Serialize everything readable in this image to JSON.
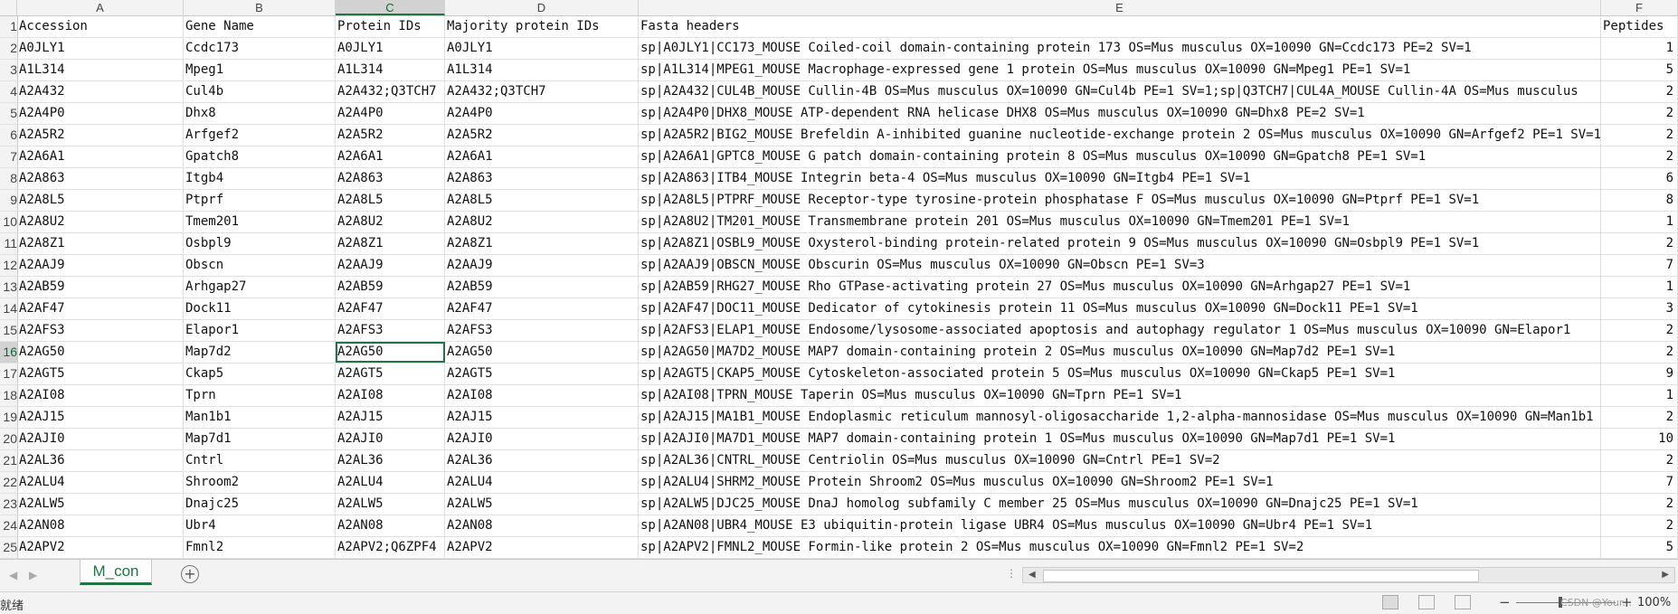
{
  "columns": [
    "A",
    "B",
    "C",
    "D",
    "E",
    "F"
  ],
  "selected_column": "C",
  "headers": {
    "rownum": "1",
    "cells": [
      "Accession",
      "Gene Name",
      "Protein IDs",
      "Majority protein IDs",
      "Fasta headers",
      "Peptides"
    ]
  },
  "rows": [
    {
      "n": "2",
      "cells": [
        "A0JLY1",
        "Ccdc173",
        "A0JLY1",
        "A0JLY1",
        "sp|A0JLY1|CC173_MOUSE Coiled-coil domain-containing protein 173 OS=Mus musculus OX=10090 GN=Ccdc173 PE=2 SV=1",
        "1"
      ]
    },
    {
      "n": "3",
      "cells": [
        "A1L314",
        "Mpeg1",
        "A1L314",
        "A1L314",
        "sp|A1L314|MPEG1_MOUSE Macrophage-expressed gene 1 protein OS=Mus musculus OX=10090 GN=Mpeg1 PE=1 SV=1",
        "5"
      ]
    },
    {
      "n": "4",
      "cells": [
        "A2A432",
        "Cul4b",
        "A2A432;Q3TCH7",
        "A2A432;Q3TCH7",
        "sp|A2A432|CUL4B_MOUSE Cullin-4B OS=Mus musculus OX=10090 GN=Cul4b PE=1 SV=1;sp|Q3TCH7|CUL4A_MOUSE Cullin-4A OS=Mus musculus",
        "2"
      ]
    },
    {
      "n": "5",
      "cells": [
        "A2A4P0",
        "Dhx8",
        "A2A4P0",
        "A2A4P0",
        "sp|A2A4P0|DHX8_MOUSE ATP-dependent RNA helicase DHX8 OS=Mus musculus OX=10090 GN=Dhx8 PE=2 SV=1",
        "2"
      ]
    },
    {
      "n": "6",
      "cells": [
        "A2A5R2",
        "Arfgef2",
        "A2A5R2",
        "A2A5R2",
        "sp|A2A5R2|BIG2_MOUSE Brefeldin A-inhibited guanine nucleotide-exchange protein 2 OS=Mus musculus OX=10090 GN=Arfgef2 PE=1 SV=1",
        "2"
      ]
    },
    {
      "n": "7",
      "cells": [
        "A2A6A1",
        "Gpatch8",
        "A2A6A1",
        "A2A6A1",
        "sp|A2A6A1|GPTC8_MOUSE G patch domain-containing protein 8 OS=Mus musculus OX=10090 GN=Gpatch8 PE=1 SV=1",
        "2"
      ]
    },
    {
      "n": "8",
      "cells": [
        "A2A863",
        "Itgb4",
        "A2A863",
        "A2A863",
        "sp|A2A863|ITB4_MOUSE Integrin beta-4 OS=Mus musculus OX=10090 GN=Itgb4 PE=1 SV=1",
        "6"
      ]
    },
    {
      "n": "9",
      "cells": [
        "A2A8L5",
        "Ptprf",
        "A2A8L5",
        "A2A8L5",
        "sp|A2A8L5|PTPRF_MOUSE Receptor-type tyrosine-protein phosphatase F OS=Mus musculus OX=10090 GN=Ptprf PE=1 SV=1",
        "8"
      ]
    },
    {
      "n": "10",
      "cells": [
        "A2A8U2",
        "Tmem201",
        "A2A8U2",
        "A2A8U2",
        "sp|A2A8U2|TM201_MOUSE Transmembrane protein 201 OS=Mus musculus OX=10090 GN=Tmem201 PE=1 SV=1",
        "1"
      ]
    },
    {
      "n": "11",
      "cells": [
        "A2A8Z1",
        "Osbpl9",
        "A2A8Z1",
        "A2A8Z1",
        "sp|A2A8Z1|OSBL9_MOUSE Oxysterol-binding protein-related protein 9 OS=Mus musculus OX=10090 GN=Osbpl9 PE=1 SV=1",
        "2"
      ]
    },
    {
      "n": "12",
      "cells": [
        "A2AAJ9",
        "Obscn",
        "A2AAJ9",
        "A2AAJ9",
        "sp|A2AAJ9|OBSCN_MOUSE Obscurin OS=Mus musculus OX=10090 GN=Obscn PE=1 SV=3",
        "7"
      ]
    },
    {
      "n": "13",
      "cells": [
        "A2AB59",
        "Arhgap27",
        "A2AB59",
        "A2AB59",
        "sp|A2AB59|RHG27_MOUSE Rho GTPase-activating protein 27 OS=Mus musculus OX=10090 GN=Arhgap27 PE=1 SV=1",
        "1"
      ]
    },
    {
      "n": "14",
      "cells": [
        "A2AF47",
        "Dock11",
        "A2AF47",
        "A2AF47",
        "sp|A2AF47|DOC11_MOUSE Dedicator of cytokinesis protein 11 OS=Mus musculus OX=10090 GN=Dock11 PE=1 SV=1",
        "3"
      ]
    },
    {
      "n": "15",
      "cells": [
        "A2AFS3",
        "Elapor1",
        "A2AFS3",
        "A2AFS3",
        "sp|A2AFS3|ELAP1_MOUSE Endosome/lysosome-associated apoptosis and autophagy regulator 1 OS=Mus musculus OX=10090 GN=Elapor1",
        "2"
      ]
    },
    {
      "n": "16",
      "cells": [
        "A2AG50",
        "Map7d2",
        "A2AG50",
        "A2AG50",
        "sp|A2AG50|MA7D2_MOUSE MAP7 domain-containing protein 2 OS=Mus musculus OX=10090 GN=Map7d2 PE=1 SV=1",
        "2"
      ]
    },
    {
      "n": "17",
      "cells": [
        "A2AGT5",
        "Ckap5",
        "A2AGT5",
        "A2AGT5",
        "sp|A2AGT5|CKAP5_MOUSE Cytoskeleton-associated protein 5 OS=Mus musculus OX=10090 GN=Ckap5 PE=1 SV=1",
        "9"
      ]
    },
    {
      "n": "18",
      "cells": [
        "A2AI08",
        "Tprn",
        "A2AI08",
        "A2AI08",
        "sp|A2AI08|TPRN_MOUSE Taperin OS=Mus musculus OX=10090 GN=Tprn PE=1 SV=1",
        "1"
      ]
    },
    {
      "n": "19",
      "cells": [
        "A2AJ15",
        "Man1b1",
        "A2AJ15",
        "A2AJ15",
        "sp|A2AJ15|MA1B1_MOUSE Endoplasmic reticulum mannosyl-oligosaccharide 1,2-alpha-mannosidase OS=Mus musculus OX=10090 GN=Man1b1",
        "2"
      ]
    },
    {
      "n": "20",
      "cells": [
        "A2AJI0",
        "Map7d1",
        "A2AJI0",
        "A2AJI0",
        "sp|A2AJI0|MA7D1_MOUSE MAP7 domain-containing protein 1 OS=Mus musculus OX=10090 GN=Map7d1 PE=1 SV=1",
        "10"
      ]
    },
    {
      "n": "21",
      "cells": [
        "A2AL36",
        "Cntrl",
        "A2AL36",
        "A2AL36",
        "sp|A2AL36|CNTRL_MOUSE Centriolin OS=Mus musculus OX=10090 GN=Cntrl PE=1 SV=2",
        "2"
      ]
    },
    {
      "n": "22",
      "cells": [
        "A2ALU4",
        "Shroom2",
        "A2ALU4",
        "A2ALU4",
        "sp|A2ALU4|SHRM2_MOUSE Protein Shroom2 OS=Mus musculus OX=10090 GN=Shroom2 PE=1 SV=1",
        "7"
      ]
    },
    {
      "n": "23",
      "cells": [
        "A2ALW5",
        "Dnajc25",
        "A2ALW5",
        "A2ALW5",
        "sp|A2ALW5|DJC25_MOUSE DnaJ homolog subfamily C member 25 OS=Mus musculus OX=10090 GN=Dnajc25 PE=1 SV=1",
        "2"
      ]
    },
    {
      "n": "24",
      "cells": [
        "A2AN08",
        "Ubr4",
        "A2AN08",
        "A2AN08",
        "sp|A2AN08|UBR4_MOUSE E3 ubiquitin-protein ligase UBR4 OS=Mus musculus OX=10090 GN=Ubr4 PE=1 SV=1",
        "2"
      ]
    },
    {
      "n": "25",
      "cells": [
        "A2APV2",
        "Fmnl2",
        "A2APV2;Q6ZPF4",
        "A2APV2",
        "sp|A2APV2|FMNL2_MOUSE Formin-like protein 2 OS=Mus musculus OX=10090 GN=Fmnl2 PE=1 SV=2",
        "5"
      ]
    }
  ],
  "active_cell": {
    "row": "16",
    "column": "C"
  },
  "sheet_tab": "M_con",
  "add_sheet_glyph": "+",
  "status_text": "就绪",
  "zoom": "100%",
  "watermark": "CSDN @Your...",
  "colors": {
    "accent": "#217346",
    "header_bg": "#f3f3f3",
    "grid": "#e1e1e1"
  }
}
